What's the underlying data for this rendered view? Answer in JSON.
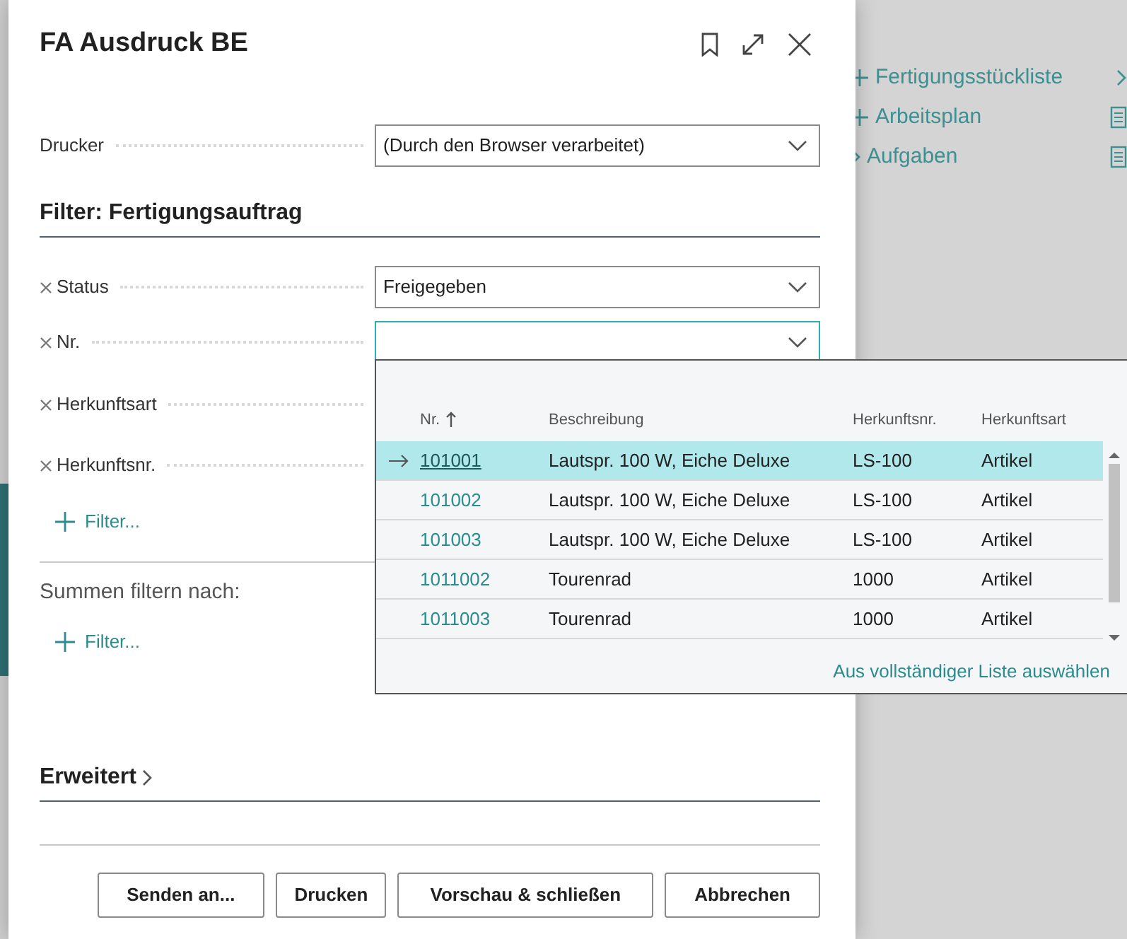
{
  "background_nav": [
    {
      "label": "Fertigungsstückliste",
      "addable": true,
      "has_submenu": true
    },
    {
      "label": "Arbeitsplan",
      "addable": true,
      "has_submenu": false
    },
    {
      "label": "Aufgaben",
      "addable": false,
      "has_submenu": false
    }
  ],
  "dialog": {
    "title": "FA Ausdruck BE",
    "printer": {
      "label": "Drucker",
      "value": "(Durch den Browser verarbeitet)"
    },
    "filter_section": {
      "title": "Filter: Fertigungsauftrag",
      "fields": [
        {
          "label": "Status",
          "kind": "select",
          "value": "Freigegeben",
          "focused": false
        },
        {
          "label": "Nr.",
          "kind": "select",
          "focused": true
        },
        {
          "label": "Herkunftsart",
          "kind": "covered"
        },
        {
          "label": "Herkunftsnr.",
          "kind": "covered"
        }
      ],
      "add_filter": "Filter..."
    },
    "totals_section": {
      "title": "Summen filtern nach:",
      "add_filter": "Filter..."
    },
    "advanced": {
      "title": "Erweitert",
      "expanded": false
    },
    "buttons": [
      "Senden an...",
      "Drucken",
      "Vorschau & schließen",
      "Abbrechen"
    ]
  },
  "lookup": {
    "columns": [
      {
        "label": "Nr.",
        "sort_ascending": true
      },
      {
        "label": "Beschreibung"
      },
      {
        "label": "Herkunftsnr."
      },
      {
        "label": "Herkunftsart"
      }
    ],
    "rows": [
      {
        "cells": [
          "101001",
          "Lautspr. 100 W, Eiche Deluxe",
          "LS-100",
          "Artikel"
        ],
        "selected": true
      },
      {
        "cells": [
          "101002",
          "Lautspr. 100 W, Eiche Deluxe",
          "LS-100",
          "Artikel"
        ],
        "selected": false
      },
      {
        "cells": [
          "101003",
          "Lautspr. 100 W, Eiche Deluxe",
          "LS-100",
          "Artikel"
        ],
        "selected": false
      },
      {
        "cells": [
          "1011002",
          "Tourenrad",
          "1000",
          "Artikel"
        ],
        "selected": false
      },
      {
        "cells": [
          "1011003",
          "Tourenrad",
          "1000",
          "Artikel"
        ],
        "selected": false
      }
    ],
    "footer_link": "Aus vollständiger Liste auswählen"
  }
}
